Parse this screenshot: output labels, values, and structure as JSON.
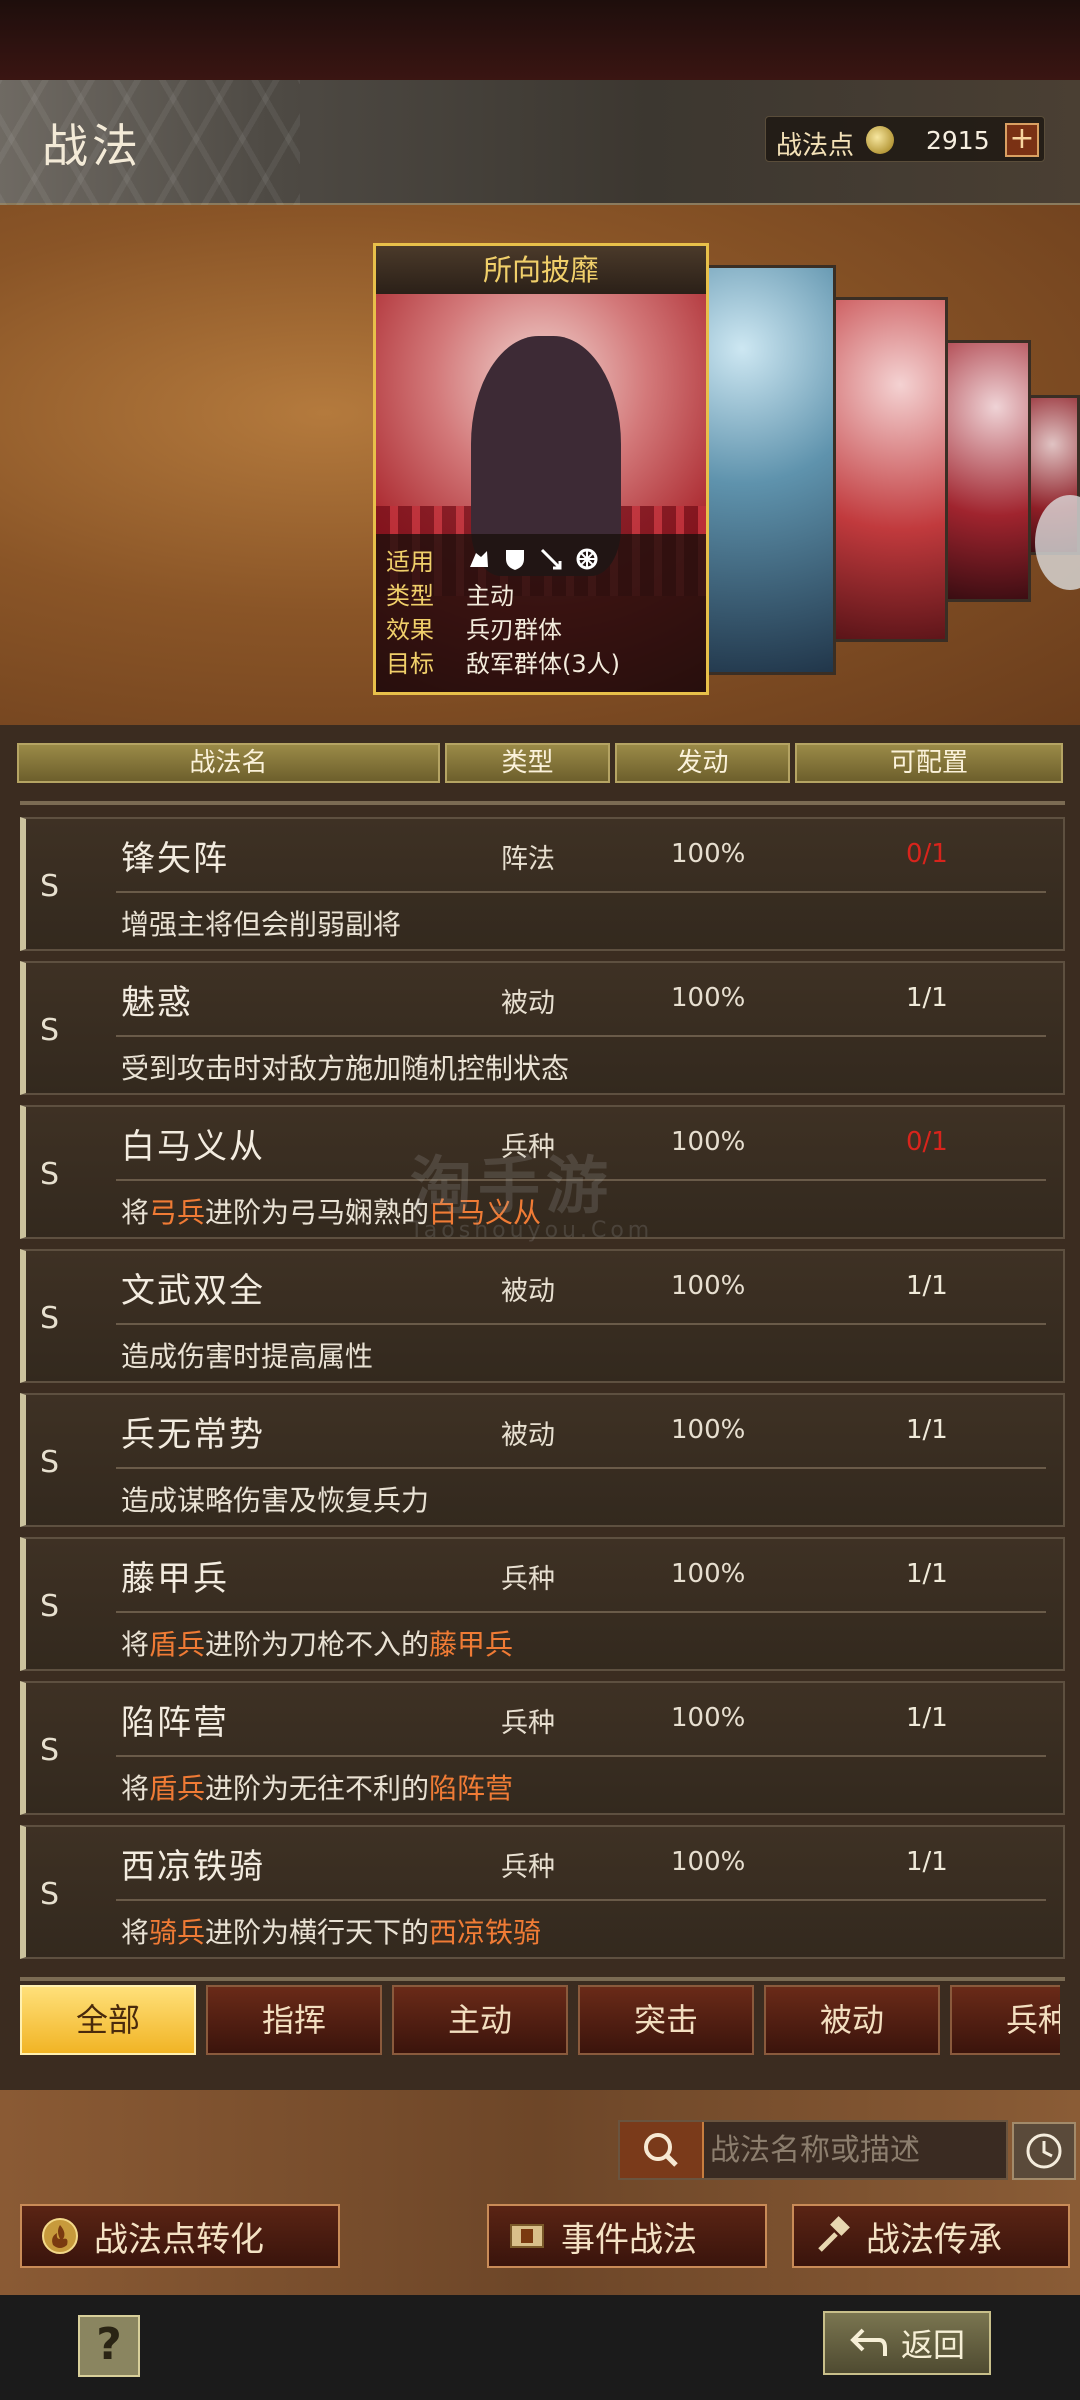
{
  "header": {
    "title": "战法",
    "points_label": "战法点",
    "points_value": "2915",
    "plus_label": "+"
  },
  "featured_card": {
    "name": "所向披靡",
    "info": [
      {
        "key": "适用",
        "value": ""
      },
      {
        "key": "类型",
        "value": "主动"
      },
      {
        "key": "效果",
        "value": "兵刃群体"
      },
      {
        "key": "目标",
        "value": "敌军群体(3人)"
      }
    ],
    "applicable_icons": [
      "cavalry-icon",
      "shield-icon",
      "archer-icon",
      "spear-wheel-icon"
    ]
  },
  "table": {
    "headers": {
      "name": "战法名",
      "type": "类型",
      "rate": "发动",
      "config": "可配置"
    },
    "rows": [
      {
        "grade": "S",
        "name": "锋矢阵",
        "type": "阵法",
        "rate": "100%",
        "config": "0/1",
        "config_red": true,
        "desc": [
          {
            "t": "增强主将但会削弱副将"
          }
        ]
      },
      {
        "grade": "S",
        "name": "魅惑",
        "type": "被动",
        "rate": "100%",
        "config": "1/1",
        "config_red": false,
        "desc": [
          {
            "t": "受到攻击时对敌方施加随机控制状态"
          }
        ]
      },
      {
        "grade": "S",
        "name": "白马义从",
        "type": "兵种",
        "rate": "100%",
        "config": "0/1",
        "config_red": true,
        "desc": [
          {
            "t": "将"
          },
          {
            "t": "弓兵",
            "hl": true
          },
          {
            "t": "进阶为弓马娴熟的"
          },
          {
            "t": "白马义从",
            "hl": true
          }
        ]
      },
      {
        "grade": "S",
        "name": "文武双全",
        "type": "被动",
        "rate": "100%",
        "config": "1/1",
        "config_red": false,
        "desc": [
          {
            "t": "造成伤害时提高属性"
          }
        ]
      },
      {
        "grade": "S",
        "name": "兵无常势",
        "type": "被动",
        "rate": "100%",
        "config": "1/1",
        "config_red": false,
        "desc": [
          {
            "t": "造成谋略伤害及恢复兵力"
          }
        ]
      },
      {
        "grade": "S",
        "name": "藤甲兵",
        "type": "兵种",
        "rate": "100%",
        "config": "1/1",
        "config_red": false,
        "desc": [
          {
            "t": "将"
          },
          {
            "t": "盾兵",
            "hl": true
          },
          {
            "t": "进阶为刀枪不入的"
          },
          {
            "t": "藤甲兵",
            "hl": true
          }
        ]
      },
      {
        "grade": "S",
        "name": "陷阵营",
        "type": "兵种",
        "rate": "100%",
        "config": "1/1",
        "config_red": false,
        "desc": [
          {
            "t": "将"
          },
          {
            "t": "盾兵",
            "hl": true
          },
          {
            "t": "进阶为无往不利的"
          },
          {
            "t": "陷阵营",
            "hl": true
          }
        ]
      },
      {
        "grade": "S",
        "name": "西凉铁骑",
        "type": "兵种",
        "rate": "100%",
        "config": "1/1",
        "config_red": false,
        "desc": [
          {
            "t": "将"
          },
          {
            "t": "骑兵",
            "hl": true
          },
          {
            "t": "进阶为横行天下的"
          },
          {
            "t": "西凉铁骑",
            "hl": true
          }
        ]
      }
    ]
  },
  "filter_tabs": [
    {
      "label": "全部",
      "active": true
    },
    {
      "label": "指挥",
      "active": false
    },
    {
      "label": "主动",
      "active": false
    },
    {
      "label": "突击",
      "active": false
    },
    {
      "label": "被动",
      "active": false
    },
    {
      "label": "兵种",
      "active": false
    }
  ],
  "search": {
    "placeholder": "战法名称或描述"
  },
  "actions": {
    "convert": "战法点转化",
    "event": "事件战法",
    "inherit": "战法传承"
  },
  "footer": {
    "help": "?",
    "back": "返回"
  },
  "watermark": {
    "main": "淘手游",
    "sub": "Taoshouyou.Com"
  },
  "colors": {
    "accent_gold": "#f0cf6a",
    "highlight_orange": "#f07b35",
    "config_red": "#d8241c",
    "active_tab": "#f1b425"
  }
}
